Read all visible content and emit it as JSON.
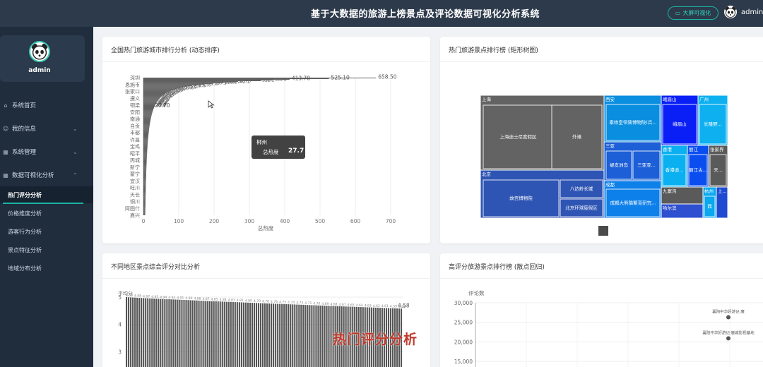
{
  "header": {
    "title": "基于大数据的旅游上榜景点及评论数据可视化分析系统",
    "bigscreen_label": "大屏可视化",
    "username": "admin"
  },
  "sidebar": {
    "username": "admin",
    "menu": [
      {
        "label": "系统首页",
        "icon": "home-icon"
      },
      {
        "label": "我的信息",
        "icon": "user-icon"
      },
      {
        "label": "系统管理",
        "icon": "grid-icon"
      },
      {
        "label": "数据可视化分析",
        "icon": "grid-icon"
      }
    ],
    "submenu": [
      "热门评分分析",
      "价格维度分析",
      "游客行为分析",
      "景点特征分析",
      "地域分布分析"
    ]
  },
  "cards": {
    "c1_title": "全国热门旅游城市排行分析 (动态排序)",
    "c2_title": "热门旅游景点排行榜 (矩形树图)",
    "c3_title": "不同地区景点综合评分对比分析",
    "c4_title": "高评分旅游景点排行榜 (散点回归)"
  },
  "tooltip": {
    "city": "郴州",
    "metric": "总热度",
    "value": "27.7"
  },
  "watermark": "热门评分分析",
  "chart_data": [
    {
      "type": "bar",
      "orientation": "horizontal",
      "categories": [
        "深圳",
        "恩施市",
        "张家口",
        "遵义",
        "铜梁",
        "安阳",
        "南通",
        "自贡",
        "丰都",
        "许昌",
        "宝鸡",
        "昭平",
        "丙城",
        "新宁",
        "蒙宁",
        "宜汉",
        "旺川",
        "天长",
        "铜川",
        "阿图什",
        "嘉兴"
      ],
      "top_values": [
        658.5,
        525.1,
        413.7,
        366.39,
        332.13,
        267.74,
        262.05,
        226.32
      ],
      "highlight_label": "27.70",
      "xlabel": "总热度",
      "xlim": [
        0,
        700
      ],
      "xticks": [
        0,
        100,
        200,
        300,
        400,
        500,
        600,
        700
      ]
    },
    {
      "type": "treemap",
      "groups": [
        {
          "name": "上海",
          "color": "#636363",
          "children": [
            "上海迪士尼度假区",
            "外滩"
          ]
        },
        {
          "name": "北京",
          "color": "#2f55b4",
          "children": [
            "故宫博物院",
            "八达岭长城",
            "北京环球度假区"
          ]
        },
        {
          "name": "西安",
          "color": "#0a8ee0",
          "children": [
            "秦始皇帝陵博物院(兵..."
          ]
        },
        {
          "name": "三亚",
          "color": "#1c5fd6",
          "children": [
            "蜈支洲岛",
            "三亚亚..."
          ]
        },
        {
          "name": "成都",
          "color": "#0e80ea",
          "children": [
            "成都大熊猫繁育研究..."
          ]
        },
        {
          "name": "峨眉山",
          "color": "#0a1ff5",
          "children": [
            "峨眉山"
          ]
        },
        {
          "name": "广州",
          "color": "#0fb0f0",
          "children": [
            "长隆野..."
          ]
        },
        {
          "name": "香港",
          "color": "#0ab0f0",
          "children": [
            "香港迪..."
          ]
        },
        {
          "name": "丽江",
          "color": "#0a4ef0",
          "children": [
            "丽江古..."
          ]
        },
        {
          "name": "张家界",
          "color": "#5a5a5a",
          "children": [
            "天..."
          ]
        },
        {
          "name": "九寨沟",
          "color": "#5a5a5a",
          "children": []
        },
        {
          "name": "哈尔滨",
          "color": "#2d4fd0",
          "children": []
        },
        {
          "name": "杭州",
          "color": "#0aa8ee",
          "children": [
            "西"
          ]
        },
        {
          "name": "上...",
          "color": "#1f4bd2",
          "children": []
        }
      ]
    },
    {
      "type": "bar",
      "ylabel": "平均分",
      "yticks": [
        3,
        4,
        5
      ],
      "ylim": [
        2.6,
        5
      ],
      "first_value": 5.0,
      "last_value": 4.58,
      "last_label": "4.58"
    },
    {
      "type": "scatter",
      "ylabel": "评论数",
      "yticks": [
        "15,000",
        "20,000",
        "25,000",
        "30,000"
      ],
      "ylim": [
        13500,
        30000
      ],
      "points": [
        {
          "label": "襄阳中华好游记·唐",
          "y": 26300
        },
        {
          "label": "襄阳中华好游记·唐城影视基地",
          "y": 20900
        }
      ]
    }
  ]
}
